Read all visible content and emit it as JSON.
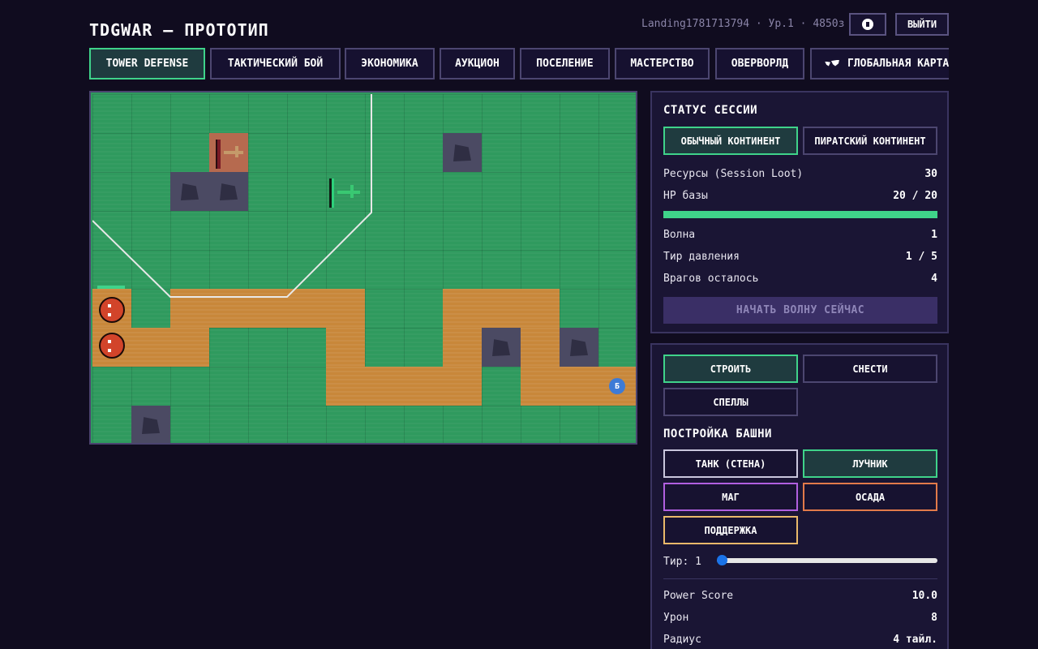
{
  "header": {
    "title": "TDGWAR — ПРОТОТИП",
    "user_info": "Landing1781713794 · Ур.1 · 4850з",
    "sound_icon": "speaker-mute-icon",
    "exit_label": "ВЫЙТИ"
  },
  "tabs": [
    {
      "label": "TOWER DEFENSE",
      "active": true
    },
    {
      "label": "ТАКТИЧЕСКИЙ БОЙ",
      "active": false
    },
    {
      "label": "ЭКОНОМИКА",
      "active": false
    },
    {
      "label": "АУКЦИОН",
      "active": false
    },
    {
      "label": "ПОСЕЛЕНИЕ",
      "active": false
    },
    {
      "label": "МАСТЕРСТВО",
      "active": false
    },
    {
      "label": "ОВЕРВОРЛД",
      "active": false
    },
    {
      "label": "ГЛОБАЛЬНАЯ КАРТА",
      "active": false,
      "icon": "world-map-icon"
    }
  ],
  "board": {
    "base_marker": "Б"
  },
  "session": {
    "title": "СТАТУС СЕССИИ",
    "continent_normal": "ОБЫЧНЫЙ КОНТИНЕНТ",
    "continent_pirate": "ПИРАТСКИЙ КОНТИНЕНТ",
    "resources_label": "Ресурсы (Session Loot)",
    "resources_value": "30",
    "base_hp_label": "HP базы",
    "base_hp_value": "20 / 20",
    "base_hp_fraction": 1.0,
    "wave_label": "Волна",
    "wave_value": "1",
    "pressure_label": "Тир давления",
    "pressure_value": "1 / 5",
    "enemies_label": "Врагов осталось",
    "enemies_value": "4",
    "start_wave_label": "НАЧАТЬ ВОЛНУ СЕЙЧАС"
  },
  "build": {
    "mode_build": "СТРОИТЬ",
    "mode_demolish": "СНЕСТИ",
    "mode_spells": "СПЕЛЛЫ",
    "tower_title": "ПОСТРОЙКА БАШНИ",
    "tower_tank": "ТАНК (СТЕНА)",
    "tower_archer": "ЛУЧНИК",
    "tower_mage": "МАГ",
    "tower_siege": "ОСАДА",
    "tower_support": "ПОДДЕРЖКА",
    "tier_label": "Тир: 1",
    "tier_value": 1,
    "power_label": "Power Score",
    "power_value": "10.0",
    "damage_label": "Урон",
    "damage_value": "8",
    "radius_label": "Радиус",
    "radius_value": "4 тайл."
  },
  "colors": {
    "accent_active": "#3fd38a",
    "mage": "#b15fe0",
    "siege": "#e27a4a",
    "support": "#e9b96a",
    "tank": "#c9c6dc"
  }
}
